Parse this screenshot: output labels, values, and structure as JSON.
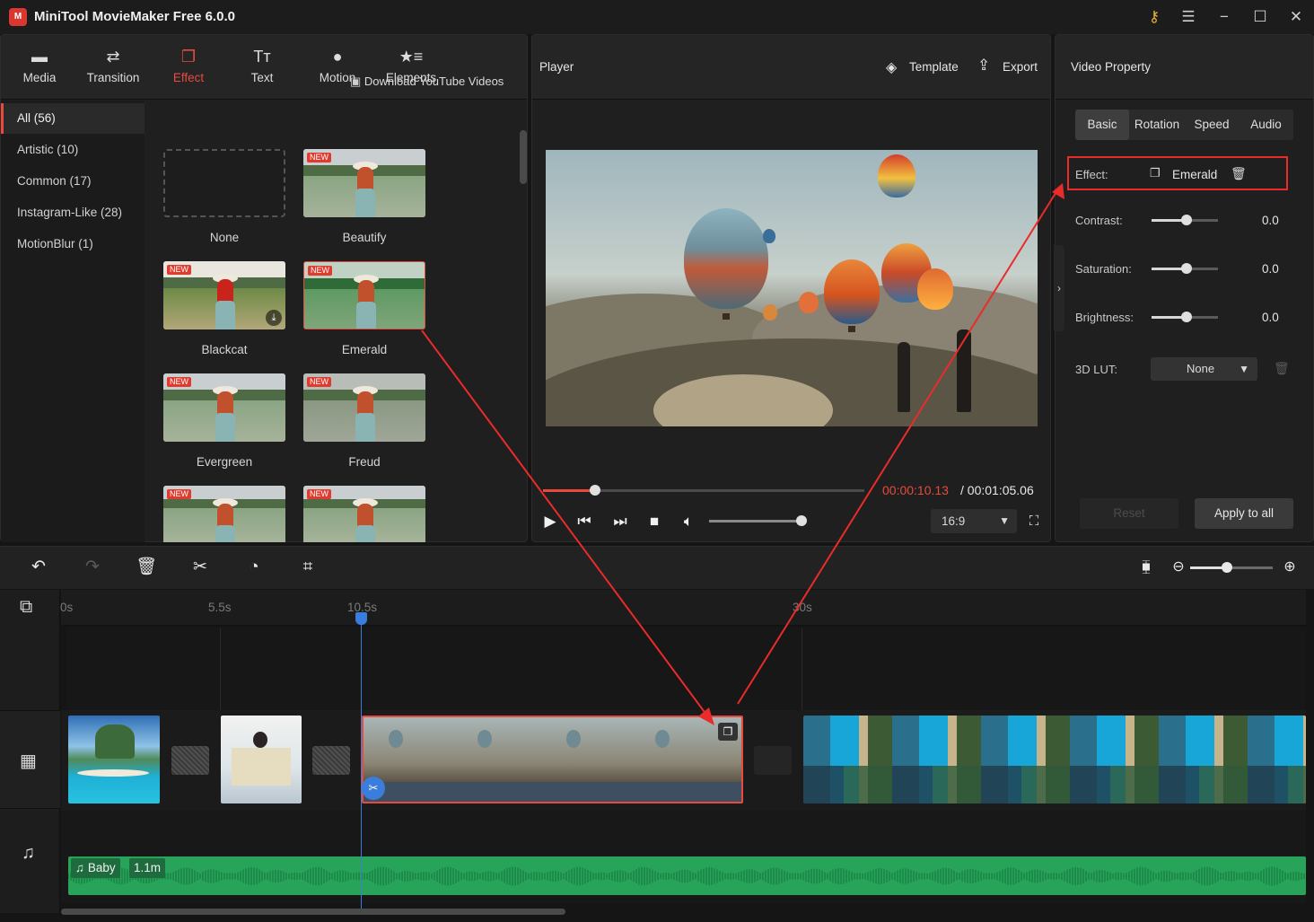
{
  "window": {
    "title": "MiniTool MovieMaker Free 6.0.0",
    "logo_text": "M"
  },
  "library": {
    "tabs": [
      {
        "label": "Media",
        "icon": "folder-icon",
        "glyph": "▬"
      },
      {
        "label": "Transition",
        "icon": "transition-icon",
        "glyph": "⇄"
      },
      {
        "label": "Effect",
        "icon": "effect-icon",
        "glyph": "❐",
        "active": true
      },
      {
        "label": "Text",
        "icon": "text-icon",
        "glyph": "Tт"
      },
      {
        "label": "Motion",
        "icon": "motion-icon",
        "glyph": "●"
      },
      {
        "label": "Elements",
        "icon": "elements-icon",
        "glyph": "★≡"
      }
    ],
    "categories": [
      "All (56)",
      "Artistic (10)",
      "Common (17)",
      "Instagram-Like (28)",
      "MotionBlur (1)"
    ],
    "download_link": "Download YouTube Videos",
    "effects": [
      "None",
      "Beautify",
      "Blackcat",
      "Emerald",
      "Evergreen",
      "Freud"
    ],
    "new_tag": "NEW"
  },
  "player": {
    "title": "Player",
    "template_label": "Template",
    "export_label": "Export",
    "time_current": "00:00:10.13",
    "time_total": "/ 00:01:05.06",
    "aspect": "16:9",
    "progress": 0.16,
    "volume": 0.95
  },
  "properties": {
    "title": "Video Property",
    "tabs": [
      "Basic",
      "Rotation",
      "Speed",
      "Audio"
    ],
    "effect_label": "Effect:",
    "effect_value": "Emerald",
    "contrast_label": "Contrast:",
    "contrast_value": "0.0",
    "saturation_label": "Saturation:",
    "saturation_value": "0.0",
    "brightness_label": "Brightness:",
    "brightness_value": "0.0",
    "lut_label": "3D LUT:",
    "lut_value": "None",
    "reset_label": "Reset",
    "apply_label": "Apply to all"
  },
  "timeline": {
    "ruler": [
      "0s",
      "5.5s",
      "10.5s",
      "30s"
    ],
    "audio_title": "Baby",
    "audio_length": "1.1m",
    "zoom_level": 0.45
  },
  "colors": {
    "accent": "#e84a3e",
    "playhead": "#3b7ddd",
    "audio": "#27a35a",
    "highlight": "#ea2b2b"
  }
}
